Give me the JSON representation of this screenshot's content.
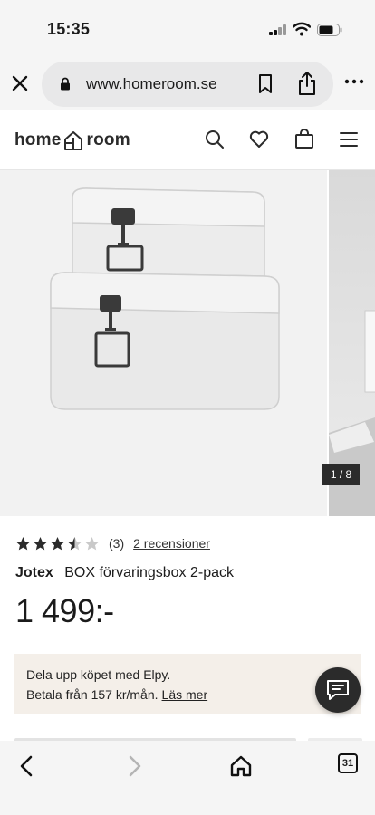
{
  "status": {
    "time": "15:35"
  },
  "browser": {
    "url": "www.homeroom.se"
  },
  "site": {
    "logo_left": "home",
    "logo_right": "room"
  },
  "gallery": {
    "counter": "1 / 8",
    "current_image": 1,
    "total_images": 8
  },
  "product": {
    "rating": 3.5,
    "rating_max": 5,
    "review_count": "(3)",
    "review_link": "2 recensioner",
    "brand": "Jotex",
    "name": "BOX förvaringsbox 2-pack",
    "price": "1 499:-"
  },
  "payment": {
    "line1": "Dela upp köpet med Elpy.",
    "line2": "Betala från 157 kr/mån.",
    "link": "Läs mer"
  },
  "toolbar": {
    "tab_count": "31"
  },
  "colors": {
    "chrome_bg": "#f5f5f5",
    "url_pill": "#e8e8e9",
    "payment_bg": "#f4efe9",
    "dark": "#2b2b2b"
  },
  "icons": [
    "signal-icon",
    "wifi-icon",
    "battery-icon",
    "close-icon",
    "lock-icon",
    "bookmark-icon",
    "share-icon",
    "more-icon",
    "search-icon",
    "heart-icon",
    "bag-icon",
    "menu-icon",
    "chat-icon",
    "back-icon",
    "forward-icon",
    "home-icon",
    "tabs-icon"
  ]
}
